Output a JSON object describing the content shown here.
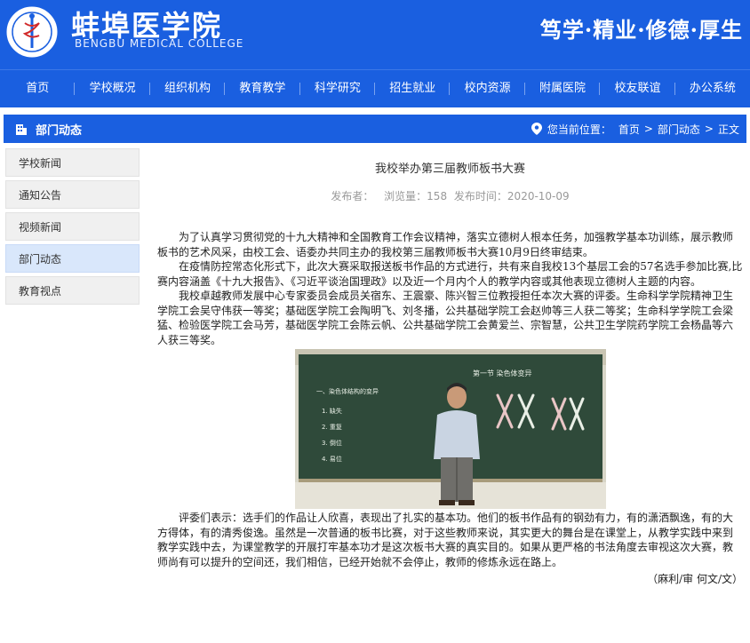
{
  "header": {
    "title_cn": "蚌埠医学院",
    "title_en": "BENGBU MEDICAL COLLEGE",
    "slogan": "笃学·精业·修德·厚生",
    "colors": {
      "brand": "#1a5fe0",
      "active_bg": "#d9e7fb"
    }
  },
  "nav": {
    "items": [
      "首页",
      "学校概况",
      "组织机构",
      "教育教学",
      "科学研究",
      "招生就业",
      "校内资源",
      "附属医院",
      "校友联谊",
      "办公系统"
    ]
  },
  "section_bar": {
    "icon": "building-icon",
    "title": "部门动态",
    "location_label": "您当前位置：",
    "crumbs": [
      "首页",
      "部门动态",
      "正文"
    ],
    "separator": ">"
  },
  "sidebar": {
    "items": [
      "学校新闻",
      "通知公告",
      "视频新闻",
      "部门动态",
      "教育视点"
    ],
    "active_index": 3
  },
  "article": {
    "title": "我校举办第三届教师板书大赛",
    "meta": {
      "publisher_label": "发布者：",
      "views_label": "浏览量：",
      "views": "158",
      "time_label": "发布时间：",
      "time": "2020-10-09"
    },
    "paragraphs": [
      "为了认真学习贯彻党的十九大精神和全国教育工作会议精神，落实立德树人根本任务，加强教学基本功训练，展示教师板书的艺术风采，由校工会、语委办共同主办的我校第三届教师板书大赛10月9日终审结束。",
      "在疫情防控常态化形式下，此次大赛采取报送板书作品的方式进行，共有来自我校13个基层工会的57名选手参加比赛,比赛内容涵盖《十九大报告》、《习近平谈治国理政》以及近一个月内个人的教学内容或其他表现立德树人主题的内容。",
      "我校卓越教师发展中心专家委员会成员关宿东、王震豪、陈兴智三位教授担任本次大赛的评委。生命科学学院精神卫生学院工会吴守伟获一等奖；基础医学院工会陶明飞、刘冬播，公共基础学院工会赵帅等三人获二等奖；生命科学学院工会梁猛、检验医学院工会马芳，基础医学院工会陈云帆、公共基础学院工会黄爱兰、宗智慧，公共卫生学院药学院工会杨晶等六人获三等奖。",
      "评委们表示：选手们的作品让人欣喜，表现出了扎实的基本功。他们的板书作品有的钢劲有力，有的潇洒飘逸，有的大方得体，有的清秀俊逸。虽然是一次普通的板书比赛，对于这些教师来说，其实更大的舞台是在课堂上，从教学实践中来到教学实践中去，为课堂教学的开展打牢基本功才是这次板书大赛的真实目的。如果从更严格的书法角度去审视这次大赛，教师尚有可以提升的空间还，我们相信，已经开始就不会停止，教师的修炼永远在路上。"
    ],
    "credit": "（麻利/审 何文/文）",
    "figure": {
      "icon": "classroom-photo",
      "board_heading": "第一节 染色体变异",
      "board_lines": [
        "一、染色体结构的变异",
        "1. 缺失",
        "2. 重复",
        "3. 倒位",
        "4. 易位"
      ]
    }
  }
}
